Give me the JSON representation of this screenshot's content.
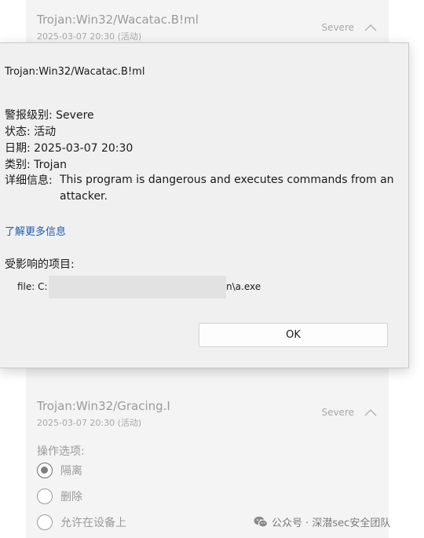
{
  "background_list": {
    "items": [
      {
        "title": "Trojan:Win32/Wacatac.B!ml",
        "date": "2025-03-07 20:30 (活动)",
        "severity": "Severe"
      },
      {
        "title": "Trojan:Win32/Gracing.I",
        "date": "2025-03-07 20:30 (活动)",
        "severity": "Severe"
      }
    ],
    "actions_heading": "操作选项:",
    "actions": [
      {
        "label": "隔离",
        "checked": true
      },
      {
        "label": "删除",
        "checked": false
      },
      {
        "label": "允许在设备上",
        "checked": false
      }
    ]
  },
  "dialog": {
    "title": "Trojan:Win32/Wacatac.B!ml",
    "alert_level": "警报级别: Severe",
    "status": "状态: 活动",
    "date": "日期:  2025-03-07 20:30",
    "category": "类别: Trojan",
    "details_label": "详细信息:",
    "details_text": "This program is dangerous and executes commands from an attacker.",
    "learn_more": "了解更多信息",
    "affected_heading": "受影响的项目:",
    "file_prefix": "file: C:",
    "file_suffix": "n\\a.exe",
    "ok_label": "OK"
  },
  "watermark": {
    "icon": "wechat-icon",
    "text": "公众号 · 深潜sec安全团队"
  },
  "colors": {
    "link": "#1f5dab",
    "dialog_bg": "#f0f0f0",
    "list_bg": "#f4f4f4"
  }
}
